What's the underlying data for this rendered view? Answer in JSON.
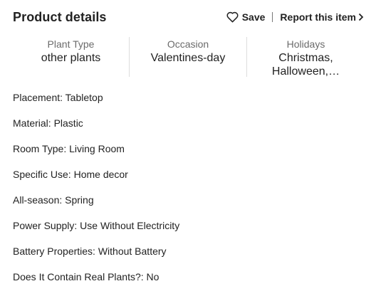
{
  "header": {
    "title": "Product details",
    "save_label": "Save",
    "report_label": "Report this item"
  },
  "attributes": [
    {
      "label": "Plant Type",
      "value": "other plants"
    },
    {
      "label": "Occasion",
      "value": "Valentines-day"
    },
    {
      "label": "Holidays",
      "value": "Christmas, Halloween,…"
    }
  ],
  "specs": [
    "Placement: Tabletop",
    "Material: Plastic",
    "Room Type: Living Room",
    "Specific Use: Home decor",
    "All-season: Spring",
    "Power Supply: Use Without Electricity",
    "Battery Properties: Without Battery",
    "Does It Contain Real Plants?: No"
  ]
}
